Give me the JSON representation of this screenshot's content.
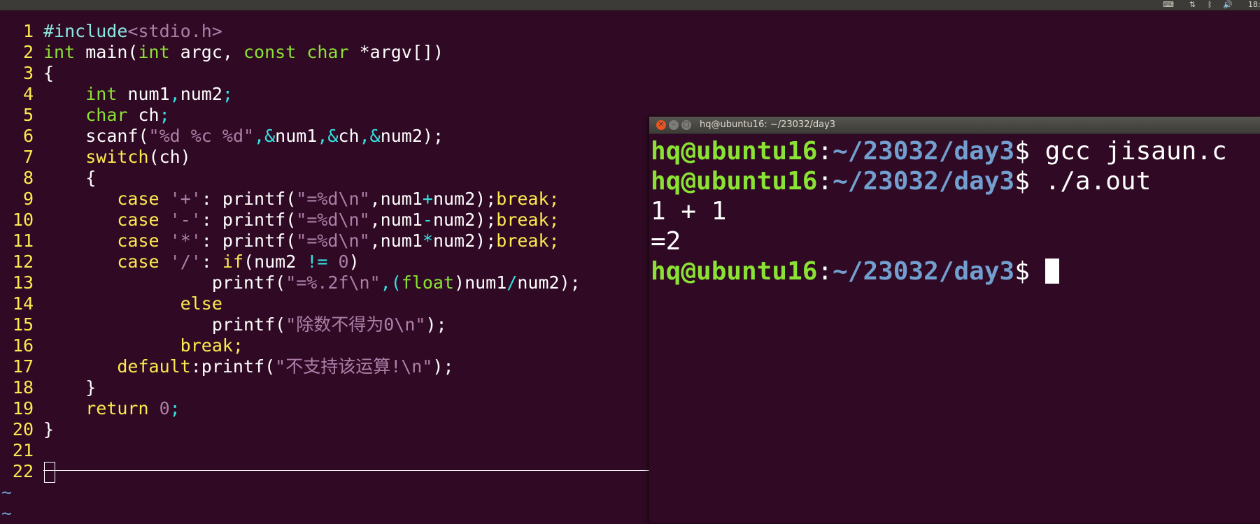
{
  "top_panel": {
    "indicators": [
      "keyboard-icon",
      "network-icon",
      "bluetooth-icon",
      "volume-icon"
    ],
    "clock": "18:"
  },
  "editor": {
    "line_numbers": [
      "1",
      "2",
      "3",
      "4",
      "5",
      "6",
      "7",
      "8",
      "9",
      "10",
      "11",
      "12",
      "13",
      "14",
      "15",
      "16",
      "17",
      "18",
      "19",
      "20",
      "21",
      "22"
    ],
    "code": {
      "l1_a": "#include",
      "l1_b": "<stdio.h>",
      "l2_a": "int",
      "l2_b": " main(",
      "l2_c": "int",
      "l2_d": " argc, ",
      "l2_e": "const",
      "l2_f": "char",
      "l2_g": "*argv[])",
      "l3": "{",
      "l4_a": "int",
      "l4_b": " num1",
      "l4_c": ",",
      "l4_d": "num2",
      "l4_e": ";",
      "l5_a": "char",
      "l5_b": " ch",
      "l5_c": ";",
      "l6_a": "scanf(",
      "l6_b": "\"%d %c %d\"",
      "l6_c": ",&",
      "l6_d": "num1",
      "l6_e": ",&",
      "l6_f": "ch",
      "l6_g": ",&",
      "l6_h": "num2);",
      "l7_a": "switch",
      "l7_b": "(ch)",
      "l8": "{",
      "l9_a": "case",
      "l9_b": "'+'",
      "l9_c": ": printf(",
      "l9_d": "\"=%d\\n\"",
      "l9_e": ",num1",
      "l9_f": "+",
      "l9_g": "num2);",
      "l9_h": "break;",
      "l10_a": "case",
      "l10_b": "'-'",
      "l10_c": ": printf(",
      "l10_d": "\"=%d\\n\"",
      "l10_e": ",num1",
      "l10_f": "-",
      "l10_g": "num2);",
      "l10_h": "break;",
      "l11_a": "case",
      "l11_b": "'*'",
      "l11_c": ": printf(",
      "l11_d": "\"=%d\\n\"",
      "l11_e": ",num1",
      "l11_f": "*",
      "l11_g": "num2);",
      "l11_h": "break;",
      "l12_a": "case",
      "l12_b": "'/'",
      "l12_c": ": ",
      "l12_d": "if",
      "l12_e": "(num2 ",
      "l12_f": "!=",
      "l12_g": "0",
      "l12_h": ")",
      "l13_a": "printf(",
      "l13_b": "\"=%.2f\\n\"",
      "l13_c": ",(",
      "l13_d": "float",
      "l13_e": ")num1",
      "l13_f": "/",
      "l13_g": "num2);",
      "l14": "else",
      "l15_a": "printf(",
      "l15_b": "\"除数不得为0\\n\"",
      "l15_c": ");",
      "l16": "break;",
      "l17_a": "default",
      "l17_b": ":printf(",
      "l17_c": "\"不支持该运算!\\n\"",
      "l17_d": ");",
      "l18": "}",
      "l19_a": "return",
      "l19_b": "0",
      "l19_c": ";",
      "l20": "}"
    },
    "tildes": [
      "~",
      "~"
    ]
  },
  "terminal": {
    "title": "hq@ubuntu16: ~/23032/day3",
    "user_host": "hq@ubuntu16",
    "colon": ":",
    "path": "~/23032/day3",
    "dollar": "$",
    "cmd1": " gcc jisaun.c",
    "cmd2": " ./a.out",
    "out1": "1 + 1",
    "out2": "=2"
  },
  "colors": {
    "background": "#300a24",
    "line_number": "#fce94f",
    "prompt_user": "#8ae234",
    "prompt_path": "#729fcf",
    "string": "#ad7fa8"
  }
}
